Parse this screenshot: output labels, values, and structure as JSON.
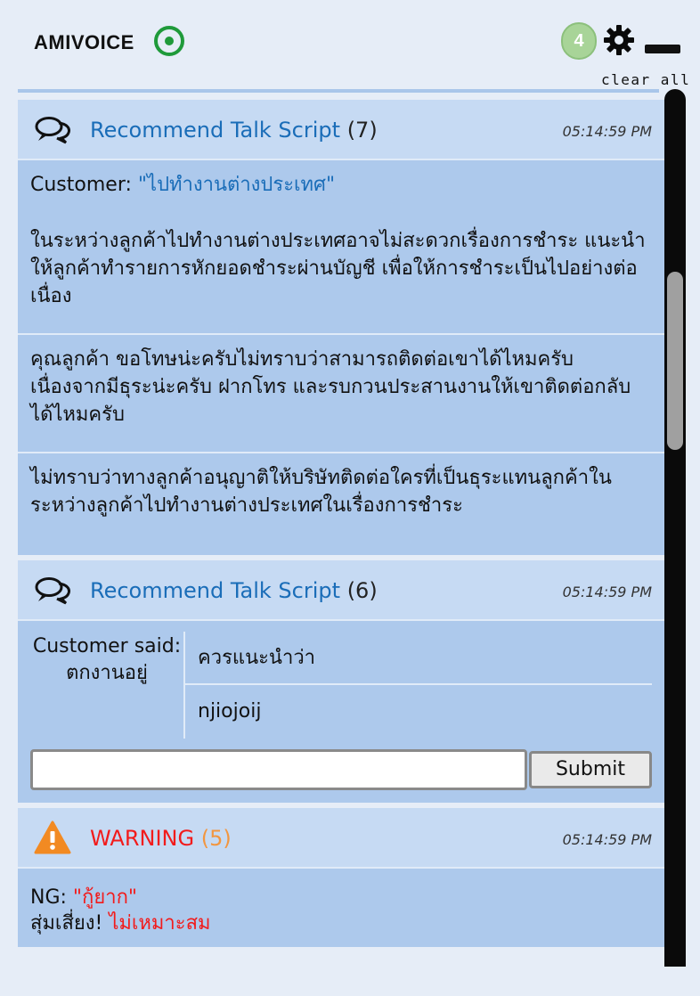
{
  "app": {
    "title": "AMIVOICE",
    "notification_count": "4",
    "clear_all_label": "clear all"
  },
  "colors": {
    "accent_blue": "#1a6db8",
    "warning_red": "#f21b1b",
    "warning_count_orange": "#f29640",
    "status_green": "#1f9a3a",
    "card_bg": "#adc9ec",
    "card_header_bg": "#c6daf3"
  },
  "icons": {
    "status": "radio-status-icon",
    "settings": "gear-icon",
    "minimize": "minimize-icon",
    "talk_script": "chat-bubbles-icon",
    "warning": "warning-triangle-icon"
  },
  "cards": [
    {
      "title": "Recommend Talk Script",
      "count": "(7)",
      "time": "05:14:59 PM",
      "customer_prefix": "Customer: ",
      "customer_quote": "\"ไปทำงานต่างประเทศ\"",
      "sections": [
        "ในระหว่างลูกค้าไปทำงานต่างประเทศอาจไม่สะดวกเรื่องการชำระ แนะนำให้ลูกค้าทำรายการหักยอดชำระผ่านบัญชี เพื่อให้การชำระเป็นไปอย่างต่อเนื่อง",
        "คุณลูกค้า ขอโทษน่ะครับไม่ทราบว่าสามารถติดต่อเขาได้ไหมครับ เนื่องจากมีธุระน่ะครับ ฝากโทร และรบกวนประสานงานให้เขาติดต่อกลับได้ไหมครับ",
        "ไม่ทราบว่าทางลูกค้าอนุญาติให้บริษัทติดต่อใครที่เป็นธุระแทนลูกค้าในระหว่างลูกค้าไปทำงานต่างประเทศในเรื่องการชำระ"
      ]
    },
    {
      "title": "Recommend Talk Script",
      "count": "(6)",
      "time": "05:14:59 PM",
      "customer_said": "Customer said: ตกงานอยู่",
      "suggestions": [
        "ควรแนะนำว่า",
        "njiojoij"
      ],
      "input_value": "",
      "input_placeholder": "",
      "submit_label": "Submit"
    },
    {
      "title": "WARNING",
      "count": "(5)",
      "time": "05:14:59 PM",
      "ng_prefix": "NG: ",
      "ng_word": "\"กู้ยาก\"",
      "risk_prefix": "สุ่มเสี่ยง! ",
      "risk_text": "ไม่เหมาะสม"
    }
  ]
}
